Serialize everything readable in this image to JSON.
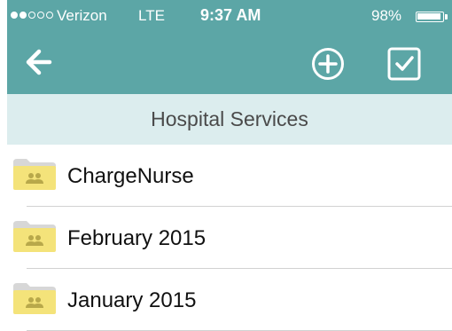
{
  "status_bar": {
    "signal_filled": 2,
    "signal_total": 5,
    "carrier": "Verizon",
    "network": "LTE",
    "time": "9:37 AM",
    "battery_percent": "98%",
    "battery_level": 0.98
  },
  "nav": {
    "back_icon": "arrow-left-icon",
    "add_icon": "circle-plus-icon",
    "select_icon": "checkbox-checked-icon"
  },
  "section": {
    "title": "Hospital Services"
  },
  "folders": [
    {
      "label": "ChargeNurse",
      "icon": "shared-folder-icon"
    },
    {
      "label": "February 2015",
      "icon": "shared-folder-icon"
    },
    {
      "label": "January 2015",
      "icon": "shared-folder-icon"
    }
  ],
  "colors": {
    "nav_background": "#5ca6a6",
    "section_background": "#dcedee",
    "folder_body": "#f4e37a",
    "folder_tab": "#d7d7d7",
    "folder_people": "#b8a84a"
  }
}
